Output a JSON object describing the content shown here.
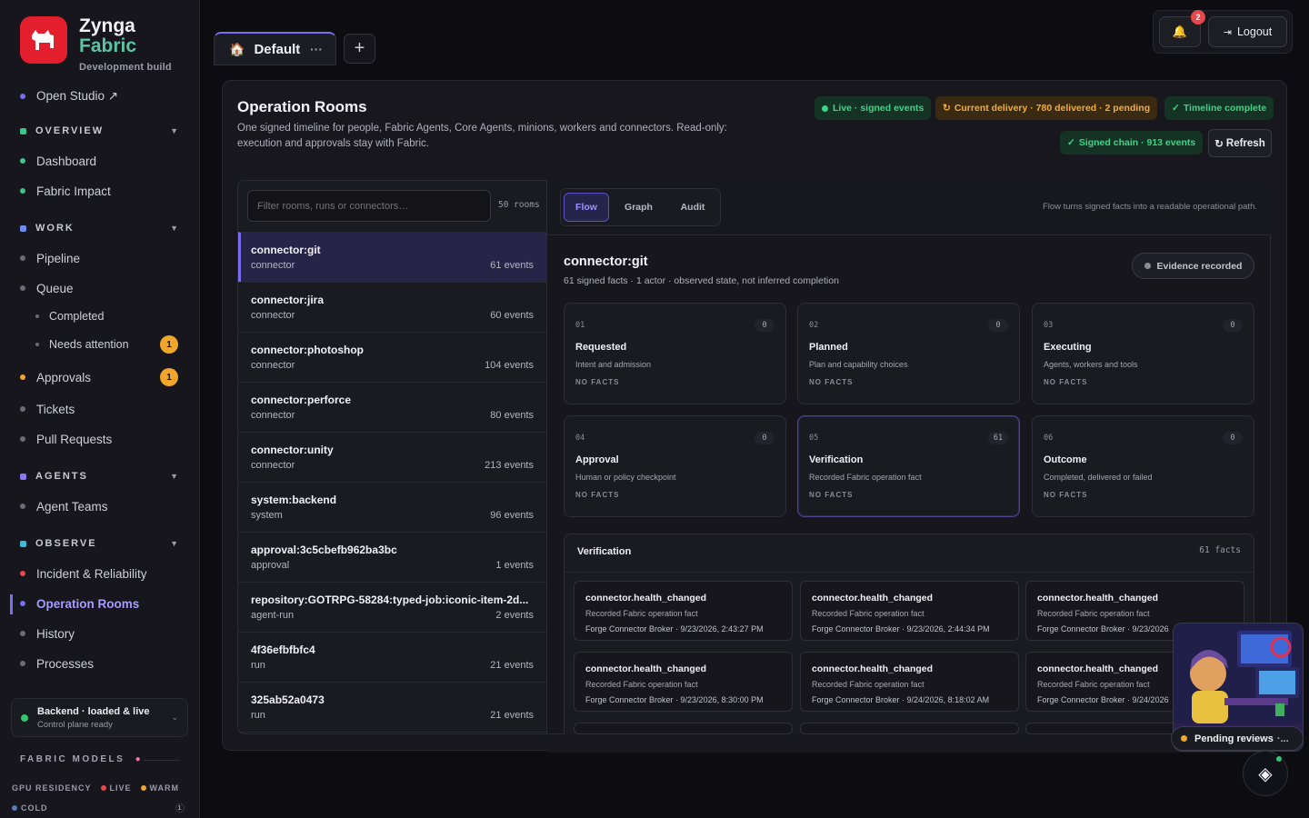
{
  "sidebar": {
    "brand": {
      "line1": "Zynga",
      "line2": "Fabric",
      "subtitle": "Development build",
      "logo_text": "zynga"
    },
    "open_studio": "Open Studio ↗",
    "sections": {
      "overview": "OVERVIEW",
      "work": "WORK",
      "agents": "AGENTS",
      "observe": "OBSERVE"
    },
    "items": {
      "dashboard": "Dashboard",
      "fabric_impact": "Fabric Impact",
      "pipeline": "Pipeline",
      "queue": "Queue",
      "completed": "Completed",
      "needs_attention": "Needs attention",
      "needs_attention_badge": "1",
      "approvals": "Approvals",
      "approvals_badge": "1",
      "tickets": "Tickets",
      "pull_requests": "Pull Requests",
      "agent_teams": "Agent Teams",
      "incident": "Incident & Reliability",
      "operation_rooms": "Operation Rooms",
      "history": "History",
      "processes": "Processes"
    },
    "backend": {
      "title": "Backend · loaded & live",
      "subtitle": "Control plane ready"
    },
    "fabric_models": {
      "title": "FABRIC MODELS",
      "gpu_residency": "GPU RESIDENCY",
      "live": "LIVE",
      "warm": "WARM",
      "cold": "COLD",
      "cold_count": "1"
    }
  },
  "topbar": {
    "tab_label": "Default",
    "tab_more": "···",
    "add_tab": "+",
    "notification_count": "2",
    "logout": "Logout"
  },
  "page": {
    "title": "Operation Rooms",
    "description": "One signed timeline for people, Fabric Agents, Core Agents, minions, workers and connectors. Read-only: execution and approvals stay with Fabric.",
    "pills": {
      "live": "Live · signed events",
      "delivery": "Current delivery · 780 delivered · 2 pending",
      "timeline": "Timeline complete",
      "chain": "Signed chain · 913 events"
    },
    "refresh": "Refresh"
  },
  "rooms": {
    "filter_placeholder": "Filter rooms, runs or connectors…",
    "count": "50 rooms",
    "list": [
      {
        "name": "connector:git",
        "kind": "connector",
        "events": "61 events"
      },
      {
        "name": "connector:jira",
        "kind": "connector",
        "events": "60 events"
      },
      {
        "name": "connector:photoshop",
        "kind": "connector",
        "events": "104 events"
      },
      {
        "name": "connector:perforce",
        "kind": "connector",
        "events": "80 events"
      },
      {
        "name": "connector:unity",
        "kind": "connector",
        "events": "213 events"
      },
      {
        "name": "system:backend",
        "kind": "system",
        "events": "96 events"
      },
      {
        "name": "approval:3c5cbefb962ba3bc",
        "kind": "approval",
        "events": "1 events"
      },
      {
        "name": "repository:GOTRPG-58284:typed-job:iconic-item-2d...",
        "kind": "agent-run",
        "events": "2 events"
      },
      {
        "name": "4f36efbfbfc4",
        "kind": "run",
        "events": "21 events"
      },
      {
        "name": "325ab52a0473",
        "kind": "run",
        "events": "21 events"
      }
    ]
  },
  "detail": {
    "tabs": {
      "flow": "Flow",
      "graph": "Graph",
      "audit": "Audit"
    },
    "note": "Flow turns signed facts into a readable operational path.",
    "title": "connector:git",
    "subtitle": "61 signed facts · 1 actor · observed state, not inferred completion",
    "evidence": "Evidence recorded",
    "stages": [
      {
        "num": "01",
        "count": "0",
        "name": "Requested",
        "desc": "Intent and admission",
        "facts": "NO FACTS"
      },
      {
        "num": "02",
        "count": "0",
        "name": "Planned",
        "desc": "Plan and capability choices",
        "facts": "NO FACTS"
      },
      {
        "num": "03",
        "count": "0",
        "name": "Executing",
        "desc": "Agents, workers and tools",
        "facts": "NO FACTS"
      },
      {
        "num": "04",
        "count": "0",
        "name": "Approval",
        "desc": "Human or policy checkpoint",
        "facts": "NO FACTS"
      },
      {
        "num": "05",
        "count": "61",
        "name": "Verification",
        "desc": "Recorded Fabric operation fact",
        "facts": "NO FACTS"
      },
      {
        "num": "06",
        "count": "0",
        "name": "Outcome",
        "desc": "Completed, delivered or failed",
        "facts": "NO FACTS"
      }
    ],
    "verification": {
      "title": "Verification",
      "count": "61 facts",
      "facts": [
        {
          "name": "connector.health_changed",
          "desc": "Recorded Fabric operation fact",
          "source": "Forge Connector Broker · 9/23/2026, 2:43:27 PM"
        },
        {
          "name": "connector.health_changed",
          "desc": "Recorded Fabric operation fact",
          "source": "Forge Connector Broker · 9/23/2026, 2:44:34 PM"
        },
        {
          "name": "connector.health_changed",
          "desc": "Recorded Fabric operation fact",
          "source": "Forge Connector Broker · 9/23/2026"
        },
        {
          "name": "connector.health_changed",
          "desc": "Recorded Fabric operation fact",
          "source": "Forge Connector Broker · 9/23/2026, 8:30:00 PM"
        },
        {
          "name": "connector.health_changed",
          "desc": "Recorded Fabric operation fact",
          "source": "Forge Connector Broker · 9/24/2026, 8:18:02 AM"
        },
        {
          "name": "connector.health_changed",
          "desc": "Recorded Fabric operation fact",
          "source": "Forge Connector Broker · 9/24/2026"
        }
      ]
    }
  },
  "widget": {
    "pending_label": "Pending reviews",
    "dots": "·..."
  }
}
